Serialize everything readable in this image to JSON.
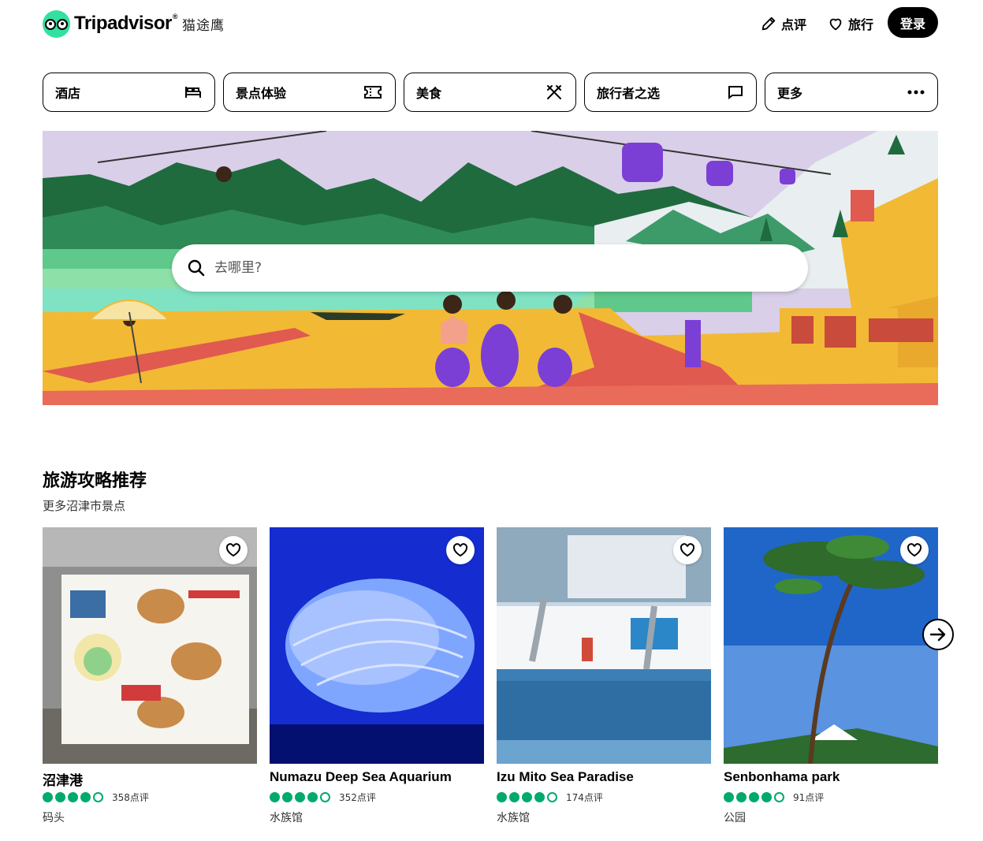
{
  "header": {
    "brand": "Tripadvisor",
    "brand_mark": "®",
    "brand_cn": "猫途鹰",
    "review_label": "点评",
    "trips_label": "旅行",
    "login_label": "登录"
  },
  "categories": [
    {
      "label": "酒店",
      "icon": "bed-icon"
    },
    {
      "label": "景点体验",
      "icon": "ticket-icon"
    },
    {
      "label": "美食",
      "icon": "utensils-icon"
    },
    {
      "label": "旅行者之选",
      "icon": "flag-icon"
    },
    {
      "label": "更多",
      "icon": "more-icon"
    }
  ],
  "search": {
    "placeholder": "去哪里?"
  },
  "section": {
    "title": "旅游攻略推荐",
    "subtitle": "更多沼津市景点"
  },
  "cards": [
    {
      "name": "沼津港",
      "rating": 4,
      "reviews": "358点评",
      "type": "码头",
      "accent": "#3a6ea5"
    },
    {
      "name": "Numazu Deep Sea Aquarium",
      "rating": 4,
      "reviews": "352点评",
      "type": "水族馆",
      "accent": "#1d3df0"
    },
    {
      "name": "Izu Mito Sea Paradise",
      "rating": 4,
      "reviews": "174点评",
      "type": "水族馆",
      "accent": "#2c87c9"
    },
    {
      "name": "Senbonhama park",
      "rating": 4,
      "reviews": "91点评",
      "type": "公园",
      "accent": "#1f66c8"
    }
  ],
  "colors": {
    "brand_green": "#34e0a1",
    "rating_green": "#00aa6c"
  }
}
